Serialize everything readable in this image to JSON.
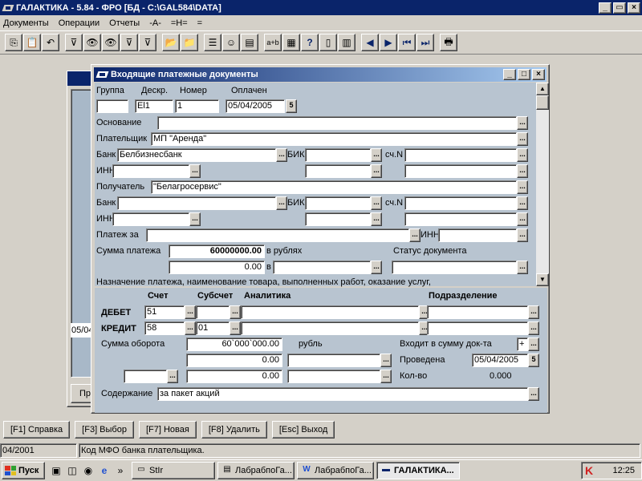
{
  "app": {
    "title": "ГАЛАКТИКА - 5.84 - ФРО [БД - C:\\GAL584\\DATA]",
    "btn_min": "_",
    "btn_restore": "▭",
    "btn_close": "×"
  },
  "menu": [
    "Документы",
    "Операции",
    "Отчеты",
    "-A-",
    "=H=",
    "="
  ],
  "toolbar": {
    "icons": [
      "copy-icon",
      "paste-icon",
      "undo-icon",
      "filter-icon",
      "binoculars-icon",
      "binoculars-next-icon",
      "filter-find-icon",
      "filter-clear-icon",
      "open-folder-icon",
      "folder-arrow-icon",
      "list-icon",
      "smiley-icon",
      "grid-icon",
      "text-case-icon",
      "calculator-icon",
      "help-icon",
      "documents-icon",
      "tree-icon",
      "prev-icon",
      "next-icon",
      "first-icon",
      "last-icon",
      "print-icon"
    ],
    "glyphs": [
      "⎘",
      "📋",
      "↶",
      "⊽",
      "👁",
      "👁",
      "⊽",
      "⊽",
      "📂",
      "📁",
      "☰",
      "☺",
      "▤",
      "a+b",
      "▦",
      "?",
      "▯",
      "▥",
      "◀",
      "▶",
      "⏮",
      "⏭",
      "🖶"
    ]
  },
  "bg_window": {
    "date": "05/04",
    "btn": "Пр"
  },
  "dialog": {
    "title": "Входящие платежные документы",
    "btn_min": "_",
    "btn_max": "□",
    "btn_close": "×",
    "hdr_group": "Группа",
    "hdr_descr": "Дескр.",
    "hdr_number": "Номер",
    "hdr_paid": "Оплачен",
    "val_group": "",
    "val_descr": "El1",
    "val_number": "1",
    "val_paid": "05/04/2005",
    "lbl_basis": "Основание",
    "val_basis": "",
    "lbl_payer": "Плательщик",
    "val_payer": "МП \"Аренда\"",
    "lbl_bank": "Банк",
    "val_payer_bank": "Белбизнесбанк",
    "lbl_bik": "БИК",
    "lbl_acc": "сч.N",
    "lbl_inn": "ИНН",
    "lbl_recipient": "Получатель",
    "val_recipient": "\"Белагросервис\"",
    "val_recipient_bank": "",
    "lbl_payment_for": "Платеж за",
    "lbl_inn2": "ИНН",
    "lbl_amount": "Сумма платежа",
    "val_amount": "60000000.00",
    "lbl_in_rub": "в рублях",
    "lbl_doc_status": "Статус документа",
    "val_amount2": "0.00",
    "lbl_v": "в",
    "lbl_purpose": "Назначение платежа, наименование товара, выполненных работ, оказание услуг,",
    "hdr_account": "Счет",
    "hdr_subaccount": "Субсчет",
    "hdr_analytics": "Аналитика",
    "hdr_department": "Подразделение",
    "lbl_debit": "ДЕБЕТ",
    "val_debit_acc": "51",
    "lbl_credit": "КРЕДИТ",
    "val_credit_acc": "58",
    "val_credit_sub": "01",
    "lbl_turnover": "Сумма оборота",
    "val_turnover": "60`000`000.00",
    "lbl_rub": "рубль",
    "lbl_included": "Входит в сумму док-та",
    "val_included": "+",
    "val_turn2": "0.00",
    "val_turn3": "0.00",
    "lbl_posted": "Проведена",
    "val_posted": "05/04/2005",
    "lbl_qty": "Кол-во",
    "val_qty": "0.000",
    "lbl_content": "Содержание",
    "val_content": "за пакет акций",
    "date_btn": "5",
    "scroll_up": "▲",
    "scroll_down": "▼",
    "dots": "..."
  },
  "fkeys": [
    "[F1] Справка",
    "[F3] Выбор",
    "[F7] Новая",
    "[F8] Удалить",
    "[Esc] Выход"
  ],
  "status": {
    "left": "04/2001",
    "message": "Код МФО банка плательщика."
  },
  "taskbar": {
    "start": "Пуск",
    "quick": [
      "desktop-icon",
      "explorer-icon",
      "media-icon",
      "browser-icon"
    ],
    "quick_glyphs": [
      "▣",
      "◫",
      "◉",
      "e"
    ],
    "quick_more": "»",
    "tasks": [
      {
        "label": "StIr",
        "glyph": "▭"
      },
      {
        "label": "ЛабрабпоГа...",
        "glyph": "▤"
      },
      {
        "label": "ЛабрабпоГа...",
        "glyph": "W"
      },
      {
        "label": "ГАЛАКТИКА...",
        "glyph": "▬"
      }
    ],
    "tray_glyph": "K",
    "clock": "12:25"
  }
}
